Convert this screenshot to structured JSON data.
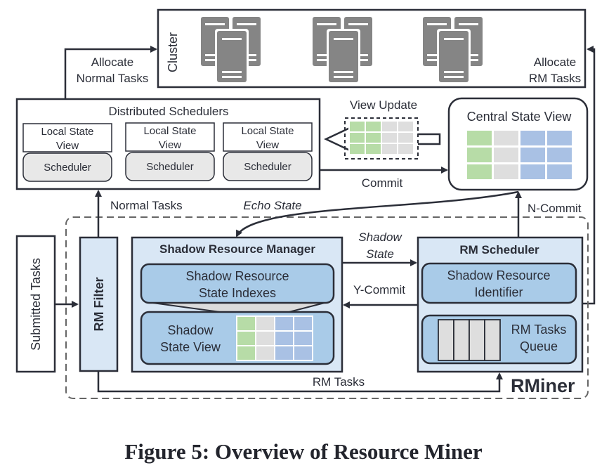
{
  "figure": {
    "caption": "Figure 5: Overview of Resource Miner"
  },
  "colors": {
    "stroke": "#2b2e38",
    "light_blue": "#d9e7f5",
    "mid_blue": "#a9cbe8",
    "green_cell": "#b7dca7",
    "gray_cell": "#dedede",
    "blue_cell": "#a9c1e4",
    "server": "#858585"
  },
  "cluster": {
    "label": "Cluster",
    "server_groups": 3
  },
  "distributed_schedulers": {
    "title": "Distributed Schedulers",
    "units": [
      {
        "view_label_line1": "Local State",
        "view_label_line2": "View",
        "scheduler_label": "Scheduler"
      },
      {
        "view_label_line1": "Local State",
        "view_label_line2": "View",
        "scheduler_label": "Scheduler"
      },
      {
        "view_label_line1": "Local State",
        "view_label_line2": "View",
        "scheduler_label": "Scheduler"
      }
    ]
  },
  "view_update": {
    "label": "View Update"
  },
  "central_state_view": {
    "title": "Central State View"
  },
  "submitted_tasks": {
    "label": "Submitted Tasks"
  },
  "rm_filter": {
    "label": "RM Filter"
  },
  "shadow_resource_manager": {
    "title": "Shadow Resource Manager",
    "indexes_line1": "Shadow Resource",
    "indexes_line2": "State Indexes",
    "view_line1": "Shadow",
    "view_line2": "State View"
  },
  "rm_scheduler": {
    "title": "RM Scheduler",
    "identifier_line1": "Shadow Resource",
    "identifier_line2": "Identifier",
    "queue_line1": "RM Tasks",
    "queue_line2": "Queue"
  },
  "rminer": {
    "label": "RMiner"
  },
  "edges": {
    "allocate_normal_line1": "Allocate",
    "allocate_normal_line2": "Normal Tasks",
    "allocate_rm_line1": "Allocate",
    "allocate_rm_line2": "RM Tasks",
    "commit": "Commit",
    "normal_tasks": "Normal Tasks",
    "echo_state": "Echo State",
    "n_commit": "N-Commit",
    "shadow_state_line1": "Shadow",
    "shadow_state_line2": "State",
    "y_commit": "Y-Commit",
    "rm_tasks": "RM Tasks"
  }
}
